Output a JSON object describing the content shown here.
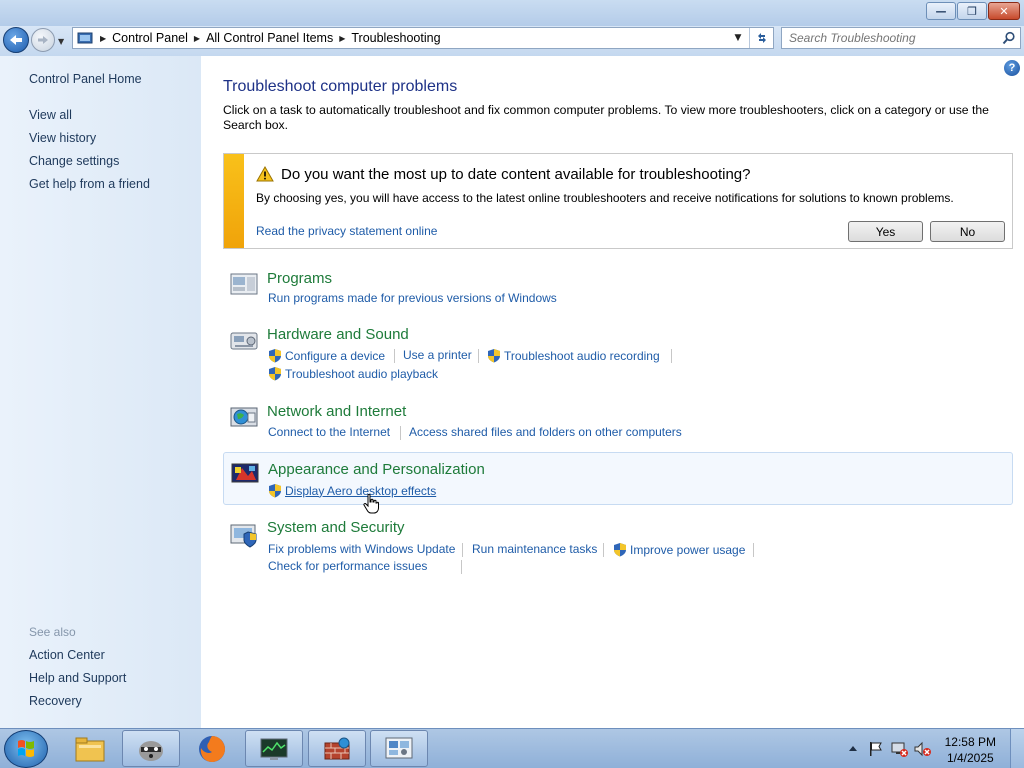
{
  "window": {
    "caption_buttons": [
      "minimize",
      "restore",
      "close"
    ]
  },
  "navbar": {
    "breadcrumbs": [
      "Control Panel",
      "All Control Panel Items",
      "Troubleshooting"
    ],
    "search_placeholder": "Search Troubleshooting"
  },
  "sidebar": {
    "home": "Control Panel Home",
    "links": [
      "View all",
      "View history",
      "Change settings",
      "Get help from a friend"
    ],
    "see_also_label": "See also",
    "see_also": [
      "Action Center",
      "Help and Support",
      "Recovery"
    ]
  },
  "main": {
    "title": "Troubleshoot computer problems",
    "intro": "Click on a task to automatically troubleshoot and fix common computer problems. To view more troubleshooters, click on a category or use the Search box.",
    "notice": {
      "title": "Do you want the most up to date content available for troubleshooting?",
      "body": "By choosing yes, you will have access to the latest online troubleshooters and receive notifications for solutions to known problems.",
      "link": "Read the privacy statement online",
      "yes": "Yes",
      "no": "No"
    },
    "categories": [
      {
        "title": "Programs",
        "tasks": [
          "Run programs made for previous versions of Windows"
        ]
      },
      {
        "title": "Hardware and Sound",
        "tasks": [
          "Configure a device",
          "Use a printer",
          "Troubleshoot audio recording",
          "Troubleshoot audio playback"
        ]
      },
      {
        "title": "Network and Internet",
        "tasks": [
          "Connect to the Internet",
          "Access shared files and folders on other computers"
        ]
      },
      {
        "title": "Appearance and Personalization",
        "tasks": [
          "Display Aero desktop effects"
        ]
      },
      {
        "title": "System and Security",
        "tasks": [
          "Fix problems with Windows Update",
          "Run maintenance tasks",
          "Improve power usage",
          "Check for performance issues"
        ]
      }
    ]
  },
  "taskbar": {
    "time": "12:58 PM",
    "date": "1/4/2025"
  },
  "colors": {
    "link": "#1f5ca8",
    "category_title": "#1e7b3a",
    "page_title": "#1e3287",
    "notice_accent": "#f4b214"
  }
}
